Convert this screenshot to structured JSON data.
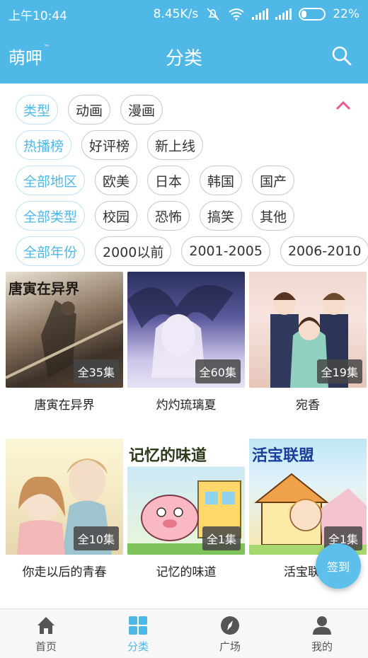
{
  "status_bar": {
    "time": "上午10:44",
    "speed": "8.45K/s",
    "battery": "22%"
  },
  "app_bar": {
    "logo": "萌呷",
    "logo_tm": "™",
    "title": "分类"
  },
  "filters": {
    "row1": [
      "类型",
      "动画",
      "漫画"
    ],
    "row2": [
      "热播榜",
      "好评榜",
      "新上线"
    ],
    "row3": [
      "全部地区",
      "欧美",
      "日本",
      "韩国",
      "国产"
    ],
    "row4": [
      "全部类型",
      "校园",
      "恐怖",
      "搞笑",
      "其他"
    ],
    "row5": [
      "全部年份",
      "2000以前",
      "2001-2005",
      "2006-2010"
    ]
  },
  "items": [
    {
      "title": "唐寅在异界",
      "episodes": "全35集",
      "cover_text": "唐寅在异界"
    },
    {
      "title": "灼灼琉璃夏",
      "episodes": "全60集",
      "cover_text": ""
    },
    {
      "title": "宛香",
      "episodes": "全19集",
      "cover_text": ""
    },
    {
      "title": "你走以后的青春",
      "episodes": "全10集",
      "cover_text": ""
    },
    {
      "title": "记忆的味道",
      "episodes": "全1集",
      "cover_text": "记忆的味道"
    },
    {
      "title": "活宝联盟",
      "episodes": "全1集",
      "cover_text": "活宝联盟"
    }
  ],
  "fab_label": "签到",
  "nav": [
    {
      "label": "首页",
      "icon": "home-icon"
    },
    {
      "label": "分类",
      "icon": "grid-icon"
    },
    {
      "label": "广场",
      "icon": "compass-icon"
    },
    {
      "label": "我的",
      "icon": "person-icon"
    }
  ],
  "colors": {
    "accent": "#4fb8e6"
  }
}
